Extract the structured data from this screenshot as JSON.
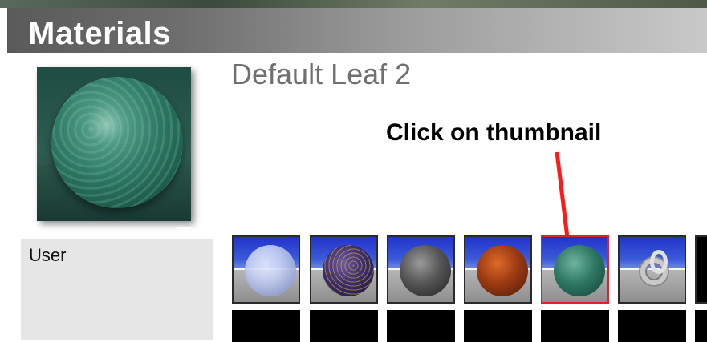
{
  "window": {
    "title": "Materials"
  },
  "material": {
    "name": "Default Leaf 2"
  },
  "library": {
    "category": "User"
  },
  "annotation": {
    "text": "Click on thumbnail",
    "color": "#ff1a1a"
  },
  "thumbnails": [
    {
      "name": "thumb-1",
      "selected": false
    },
    {
      "name": "thumb-2",
      "selected": false
    },
    {
      "name": "thumb-3",
      "selected": false
    },
    {
      "name": "thumb-4",
      "selected": false
    },
    {
      "name": "thumb-5",
      "selected": true
    },
    {
      "name": "thumb-6",
      "selected": false
    }
  ]
}
